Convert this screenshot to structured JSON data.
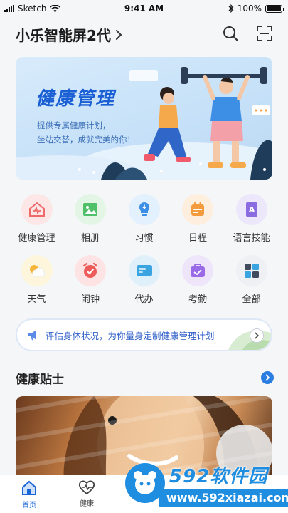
{
  "status_bar": {
    "carrier": "Sketch",
    "time": "9:41 AM",
    "battery": "100%"
  },
  "header": {
    "title": "小乐智能屏2代"
  },
  "banner": {
    "title": "健康管理",
    "subtitle_line1": "提供专属健康计划，",
    "subtitle_line2": "坐站交替，成就完美的你！"
  },
  "grid": {
    "row1": [
      {
        "label": "健康管理",
        "icon": "health-house-icon",
        "color": "#fde6e6",
        "accent": "#ef6a6a"
      },
      {
        "label": "相册",
        "icon": "photo-icon",
        "color": "#e3f6e6",
        "accent": "#4fbf6a"
      },
      {
        "label": "习惯",
        "icon": "lightbulb-icon",
        "color": "#e3f0fd",
        "accent": "#3d8fe6"
      },
      {
        "label": "日程",
        "icon": "calendar-icon",
        "color": "#fdeedd",
        "accent": "#f39b3d"
      },
      {
        "label": "语言技能",
        "icon": "language-book-icon",
        "color": "#ece7fb",
        "accent": "#8a6be0"
      }
    ],
    "row2": [
      {
        "label": "天气",
        "icon": "weather-icon",
        "color": "#fdf5dc",
        "accent": "#f5b63b"
      },
      {
        "label": "闹钟",
        "icon": "alarm-clock-icon",
        "color": "#fde3e3",
        "accent": "#ee5b5b"
      },
      {
        "label": "代办",
        "icon": "todo-icon",
        "color": "#dff0fb",
        "accent": "#3aa4e0"
      },
      {
        "label": "考勤",
        "icon": "attendance-icon",
        "color": "#efe5fb",
        "accent": "#9a6be6"
      },
      {
        "label": "全部",
        "icon": "all-apps-icon",
        "color": "#eef0f3",
        "accent": "#3f4a5c"
      }
    ]
  },
  "promo": {
    "text": "评估身体状况，为你量身定制健康管理计划"
  },
  "tips": {
    "title": "健康贴士"
  },
  "tabbar": {
    "home": "首页",
    "health": "健康"
  },
  "watermark": {
    "brand": "592软件园",
    "site": "www.592xiazai.com"
  },
  "colors": {
    "primary": "#1a66d6",
    "banner_bg": "#c6e1f8",
    "page_bg": "#f5f6f8"
  }
}
